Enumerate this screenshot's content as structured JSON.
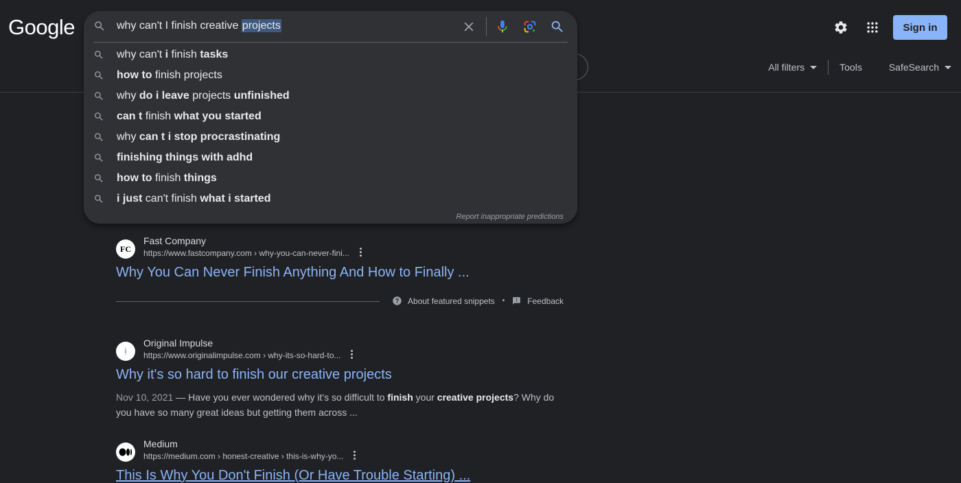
{
  "logo": "Google",
  "header": {
    "signin_label": "Sign in",
    "icons": [
      "settings-gear-icon",
      "apps-grid-icon"
    ]
  },
  "search": {
    "query_prefix": "why can't I finish creative ",
    "query_selected": "projects",
    "icons": [
      "search-icon",
      "clear-x-icon",
      "microphone-icon",
      "lens-camera-icon",
      "search-submit-icon"
    ]
  },
  "suggestions": [
    {
      "parts": [
        {
          "t": "why can't ",
          "b": false
        },
        {
          "t": "i",
          "b": true
        },
        {
          "t": " finish ",
          "b": false
        },
        {
          "t": "tasks",
          "b": true
        }
      ]
    },
    {
      "parts": [
        {
          "t": "how to",
          "b": true
        },
        {
          "t": " finish projects",
          "b": false
        }
      ]
    },
    {
      "parts": [
        {
          "t": "why ",
          "b": false
        },
        {
          "t": "do i leave",
          "b": true
        },
        {
          "t": " projects ",
          "b": false
        },
        {
          "t": "unfinished",
          "b": true
        }
      ]
    },
    {
      "parts": [
        {
          "t": "can t",
          "b": true
        },
        {
          "t": " finish ",
          "b": false
        },
        {
          "t": "what you started",
          "b": true
        }
      ]
    },
    {
      "parts": [
        {
          "t": "why ",
          "b": false
        },
        {
          "t": "can t i stop procrastinating",
          "b": true
        }
      ]
    },
    {
      "parts": [
        {
          "t": "finishing things with adhd",
          "b": true
        }
      ]
    },
    {
      "parts": [
        {
          "t": "how to",
          "b": true
        },
        {
          "t": " finish ",
          "b": false
        },
        {
          "t": "things",
          "b": true
        }
      ]
    },
    {
      "parts": [
        {
          "t": "i just",
          "b": true
        },
        {
          "t": " can't finish ",
          "b": false
        },
        {
          "t": "what i started",
          "b": true
        }
      ]
    }
  ],
  "report_link": "Report inappropriate predictions",
  "tools": {
    "all_filters": "All filters",
    "tools": "Tools",
    "safesearch": "SafeSearch"
  },
  "results": [
    {
      "site": "Fast Company",
      "url": "https://www.fastcompany.com › why-you-can-never-fini...",
      "title": "Why You Can Never Finish Anything And How to Finally ...",
      "favicon_text": "FC"
    },
    {
      "site": "Original Impulse",
      "url": "https://www.originalimpulse.com › why-its-so-hard-to...",
      "title": "Why it's so hard to finish our creative projects",
      "snippet": {
        "date": "Nov 10, 2021",
        "sep": " — ",
        "parts": [
          {
            "t": "Have you ever wondered why it's so difficult to ",
            "b": false
          },
          {
            "t": "finish",
            "b": true
          },
          {
            "t": " your ",
            "b": false
          },
          {
            "t": "creative projects",
            "b": true
          },
          {
            "t": "? Why do you have so many great ideas but getting them across ...",
            "b": false
          }
        ]
      }
    },
    {
      "site": "Medium",
      "url": "https://medium.com › honest-creative › this-is-why-yo...",
      "title": "This Is Why You Don't Finish (Or Have Trouble Starting) ..."
    }
  ],
  "snippet_footer": {
    "about": "About featured snippets",
    "dot": "•",
    "feedback": "Feedback"
  }
}
